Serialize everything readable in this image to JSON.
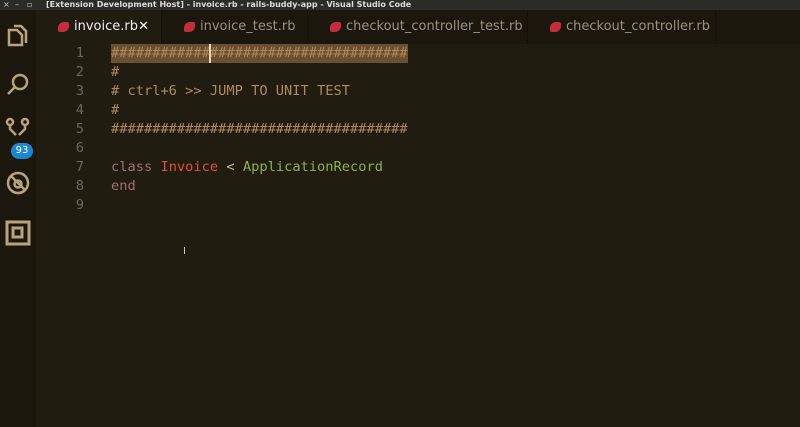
{
  "window": {
    "title": "[Extension Development Host] - invoice.rb - rails-buddy-app - Visual Studio Code",
    "controls": [
      "×",
      "–",
      "▫"
    ]
  },
  "activity_bar": {
    "items": [
      "explorer-icon",
      "search-icon",
      "source-control-icon",
      "debug-icon",
      "extensions-icon"
    ],
    "scm_badge": "93"
  },
  "tabs": [
    {
      "label": "invoice.rb",
      "active": true,
      "close": "✕"
    },
    {
      "label": "invoice_test.rb"
    },
    {
      "label": "checkout_controller_test.rb"
    },
    {
      "label": "checkout_controller.rb"
    }
  ],
  "editor": {
    "lines": [
      {
        "n": "1",
        "text": "####################################"
      },
      {
        "n": "2",
        "text": "#"
      },
      {
        "n": "3",
        "text": "# ctrl+6 >> JUMP TO UNIT TEST"
      },
      {
        "n": "4",
        "text": "#"
      },
      {
        "n": "5",
        "text": "####################################"
      },
      {
        "n": "6",
        "text": ""
      },
      {
        "n": "7",
        "kw": "class",
        "cls": "Invoice",
        "op": "<",
        "sup": "ApplicationRecord"
      },
      {
        "n": "8",
        "kw": "end"
      },
      {
        "n": "9",
        "text": ""
      }
    ],
    "mouse_cursor": "I"
  }
}
